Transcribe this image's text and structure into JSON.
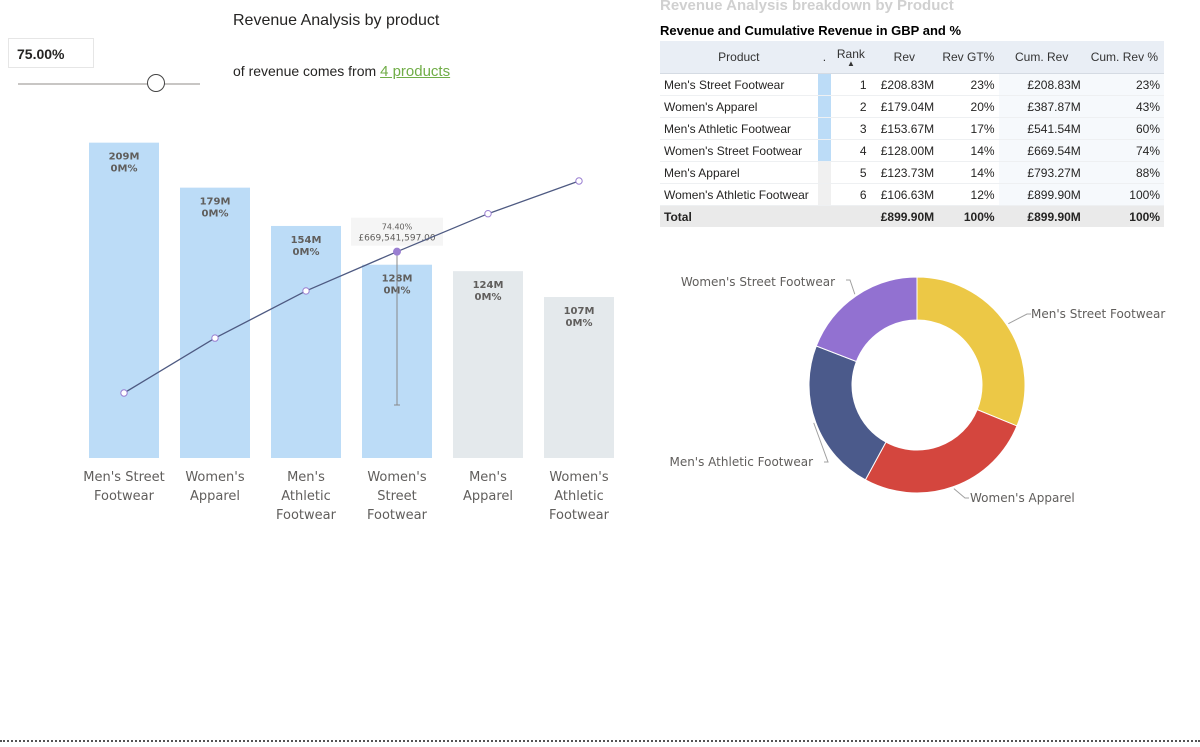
{
  "slicer": {
    "value": "75.00%",
    "level_percent": 75
  },
  "heading": "Revenue Analysis by product",
  "subheading": {
    "prefix": "of revenue comes from ",
    "accent": "4 products"
  },
  "right_panel": {
    "ghost_title": "Revenue Analysis breakdown  by Product",
    "table_title": "Revenue and Cumulative Revenue in GBP and %"
  },
  "table": {
    "columns": [
      "Product",
      ".",
      "Rank",
      "Rev",
      "Rev GT%",
      "Cum. Rev",
      "Cum. Rev %"
    ],
    "rows": [
      [
        "Men's Street Footwear",
        "",
        "1",
        "£208.83M",
        "23%",
        "£208.83M",
        "23%"
      ],
      [
        "Women's Apparel",
        "",
        "2",
        "£179.04M",
        "20%",
        "£387.87M",
        "43%"
      ],
      [
        "Men's Athletic Footwear",
        "",
        "3",
        "£153.67M",
        "17%",
        "£541.54M",
        "60%"
      ],
      [
        "Women's Street Footwear",
        "",
        "4",
        "£128.00M",
        "14%",
        "£669.54M",
        "74%"
      ],
      [
        "Men's Apparel",
        "",
        "5",
        "£123.73M",
        "14%",
        "£793.27M",
        "88%"
      ],
      [
        "Women's Athletic Footwear",
        "",
        "6",
        "£106.63M",
        "12%",
        "£899.90M",
        "100%"
      ]
    ],
    "total": [
      "Total",
      "",
      "",
      "£899.90M",
      "100%",
      "£899.90M",
      "100%"
    ],
    "highlighted_rows": 4,
    "highlight_color": "#bcdcf7"
  },
  "chart_data": [
    {
      "type": "bar",
      "categories": [
        "Men's Street Footwear",
        "Women's Apparel",
        "Men's Athletic Footwear",
        "Women's Street Footwear",
        "Men's Apparel",
        "Women's Athletic Footwear"
      ],
      "category_lines": [
        [
          "Men's Street",
          "Footwear"
        ],
        [
          "Women's",
          "Apparel"
        ],
        [
          "Men's",
          "Athletic",
          "Footwear"
        ],
        [
          "Women's",
          "Street",
          "Footwear"
        ],
        [
          "Men's",
          "Apparel"
        ],
        [
          "Women's",
          "Athletic",
          "Footwear"
        ]
      ],
      "values": [
        208.83,
        179.04,
        153.67,
        128.0,
        123.73,
        106.63
      ],
      "data_labels": [
        [
          "209M",
          "0M%"
        ],
        [
          "179M",
          "0M%"
        ],
        [
          "154M",
          "0M%"
        ],
        [
          "128M",
          "0M%"
        ],
        [
          "124M",
          "0M%"
        ],
        [
          "107M",
          "0M%"
        ]
      ],
      "bar_colors": [
        "#bcdcf7",
        "#bcdcf7",
        "#bcdcf7",
        "#bcdcf7",
        "#e4e9ec",
        "#e4e9ec"
      ],
      "line_series": {
        "values": [
          208.83,
          387.87,
          541.54,
          669.54,
          793.27,
          899.9
        ],
        "color": "#4e5a82",
        "marker_color": "#9a7fd1"
      },
      "tooltip": {
        "index": 3,
        "line1": "74.40%",
        "line2": "£669,541,597.00"
      }
    },
    {
      "type": "pie",
      "donut": true,
      "labels": [
        "Men's Street Footwear",
        "Women's Apparel",
        "Men's Athletic Footwear",
        "Women's Street Footwear"
      ],
      "values": [
        208.83,
        179.04,
        153.67,
        128.0
      ],
      "colors": [
        "#ecc846",
        "#d4463e",
        "#4b5a8b",
        "#9271d1"
      ]
    }
  ]
}
